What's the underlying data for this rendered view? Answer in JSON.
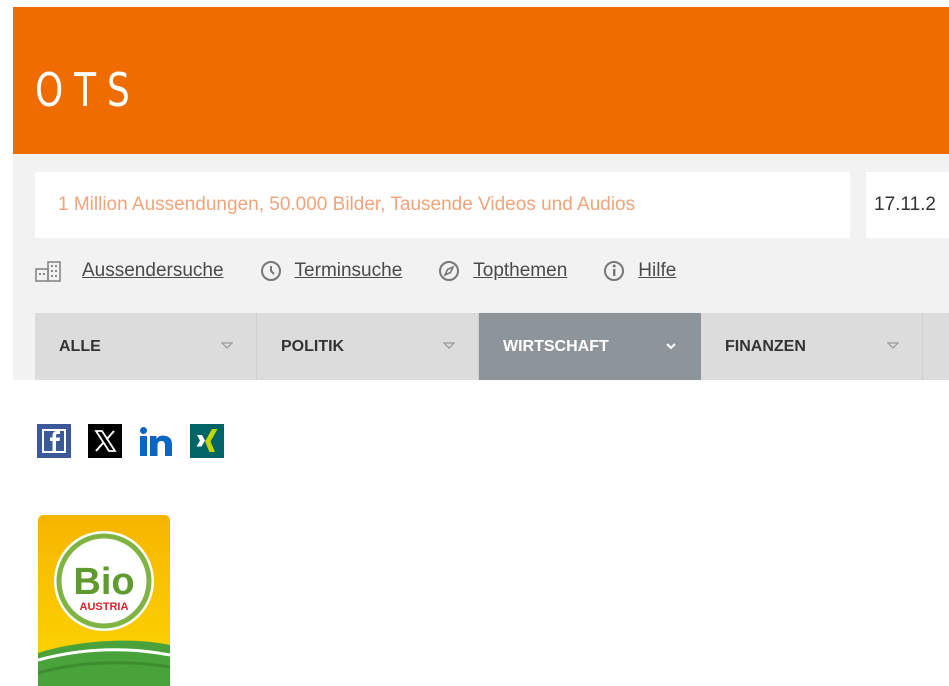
{
  "brand": {
    "logo_text": "OTS",
    "primary_color": "#ef6c00"
  },
  "search": {
    "placeholder": "1 Million Aussendungen, 50.000 Bilder, Tausende Videos und Audios",
    "date_value": "17.11.2"
  },
  "quick_links": [
    {
      "label": "Aussendersuche",
      "icon": "building-icon"
    },
    {
      "label": "Terminsuche",
      "icon": "clock-icon"
    },
    {
      "label": "Topthemen",
      "icon": "compass-icon"
    },
    {
      "label": "Hilfe",
      "icon": "info-icon"
    }
  ],
  "nav": {
    "items": [
      {
        "label": "ALLE",
        "active": false
      },
      {
        "label": "POLITIK",
        "active": false
      },
      {
        "label": "WIRTSCHAFT",
        "active": true
      },
      {
        "label": "FINANZEN",
        "active": false
      }
    ]
  },
  "share": {
    "icons": [
      "facebook-icon",
      "x-icon",
      "linkedin-icon",
      "xing-icon"
    ],
    "colors": {
      "facebook": "#3b5998",
      "x": "#000000",
      "linkedin": "#0a66c2",
      "xing": "#026466"
    }
  },
  "org_logo": {
    "text_main": "Bio",
    "text_sub": "AUSTRIA"
  }
}
